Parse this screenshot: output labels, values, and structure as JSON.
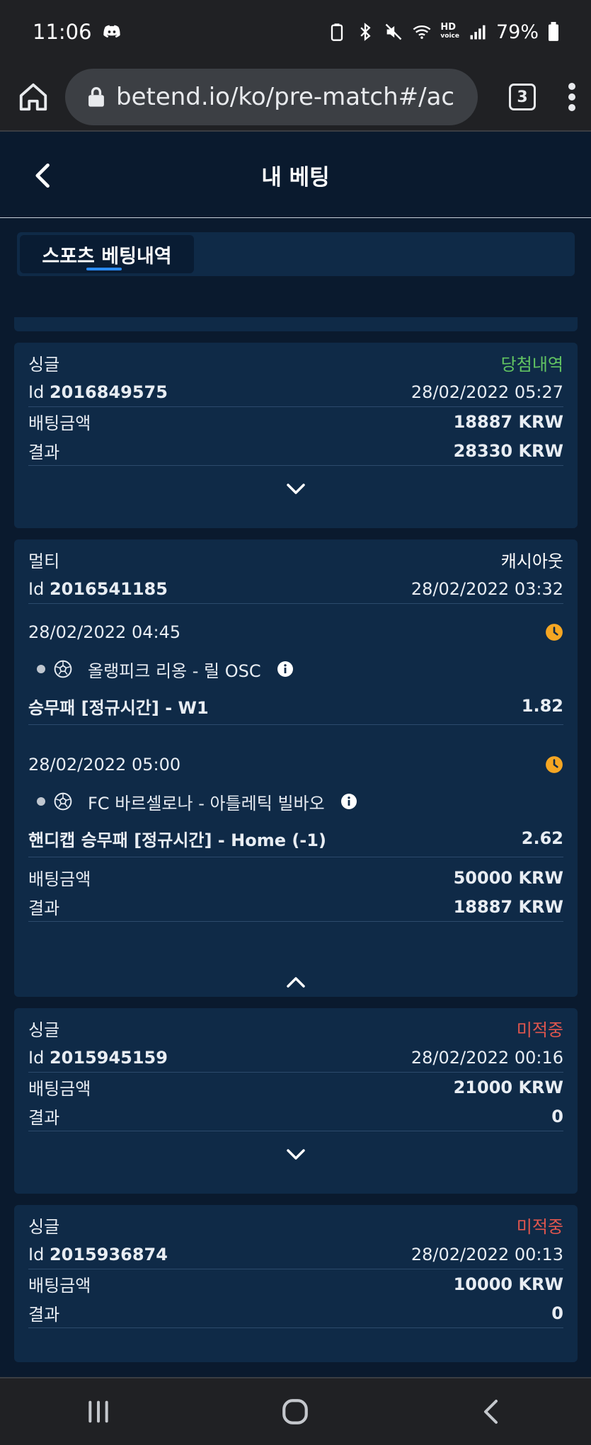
{
  "status_bar": {
    "time": "11:06",
    "battery": "79%",
    "hd_label": "HD",
    "voice_label": "voice"
  },
  "browser": {
    "url": "betend.io/ko/pre-match#/ac",
    "tab_count": "3"
  },
  "header": {
    "title": "내 베팅"
  },
  "tabs": [
    {
      "label": "스포츠 베팅내역"
    }
  ],
  "colors": {
    "win": "#62c462",
    "pending": "#e0564e",
    "accent": "#2b8cff",
    "clock": "#f5a623"
  },
  "bets": [
    {
      "type": "싱글",
      "status": "당첨내역",
      "id_label": "Id",
      "id": "2016849575",
      "datetime": "28/02/2022 05:27",
      "stake_label": "배팅금액",
      "stake": "18887 KRW",
      "result_label": "결과",
      "result": "28330 KRW"
    },
    {
      "type": "멀티",
      "status": "캐시아웃",
      "id_label": "Id",
      "id": "2016541185",
      "datetime": "28/02/2022 03:32",
      "events": [
        {
          "date": "28/02/2022 04:45",
          "match": "올랭피크 리옹 - 릴 OSC",
          "market": "승무패 [정규시간] - W1",
          "odds": "1.82"
        },
        {
          "date": "28/02/2022 05:00",
          "match": "FC 바르셀로나 - 아틀레틱 빌바오",
          "market": "핸디캡 승무패 [정규시간] - Home (-1)",
          "odds": "2.62"
        }
      ],
      "stake_label": "배팅금액",
      "stake": "50000 KRW",
      "result_label": "결과",
      "result": "18887 KRW"
    },
    {
      "type": "싱글",
      "status": "미적중",
      "id_label": "Id",
      "id": "2015945159",
      "datetime": "28/02/2022 00:16",
      "stake_label": "배팅금액",
      "stake": "21000 KRW",
      "result_label": "결과",
      "result": "0"
    },
    {
      "type": "싱글",
      "status": "미적중",
      "id_label": "Id",
      "id": "2015936874",
      "datetime": "28/02/2022 00:13",
      "stake_label": "배팅금액",
      "stake": "10000 KRW",
      "result_label": "결과",
      "result": "0"
    }
  ]
}
